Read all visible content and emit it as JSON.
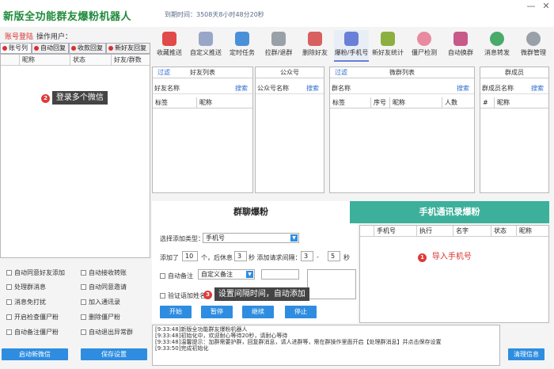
{
  "app": {
    "title": "新版全功能群友爆粉机器人",
    "expire": "到期时间：3508天8小时48分20秒",
    "login": "账号登陆",
    "op_user": "操作用户："
  },
  "window": {
    "min": "—",
    "close": "✕"
  },
  "toolbar": [
    {
      "label": "收藏推送",
      "icon": "star-icon",
      "color": "#e04a4a"
    },
    {
      "label": "自定义推送",
      "icon": "star-gear-icon",
      "color": "#9aa6c8"
    },
    {
      "label": "定时任务",
      "icon": "calendar-icon",
      "color": "#4a90d8"
    },
    {
      "label": "拉群/退群",
      "icon": "group-icon",
      "color": "#9aa0a8"
    },
    {
      "label": "删除好友",
      "icon": "delete-user-icon",
      "color": "#d86060"
    },
    {
      "label": "爆粉/手机号",
      "icon": "phone-id-icon",
      "color": "#6a7fd8"
    },
    {
      "label": "新好友统计",
      "icon": "user-stats-icon",
      "color": "#8cb040"
    },
    {
      "label": "僵尸检测",
      "icon": "zombie-face-icon",
      "color": "#e88aa0"
    },
    {
      "label": "自动换群",
      "icon": "switch-group-icon",
      "color": "#c85a8a"
    },
    {
      "label": "消息转发",
      "icon": "forward-icon",
      "color": "#4aaa6a"
    },
    {
      "label": "微群管理",
      "icon": "gear-icon",
      "color": "#9aa0a8"
    }
  ],
  "left": {
    "tabs": [
      "账号列",
      "自动回复",
      "收款回复",
      "新好友回复"
    ],
    "columns": [
      "昵称",
      "状态",
      "好友/群数"
    ],
    "tip_num": "2",
    "tip": "登录多个微信",
    "options": [
      [
        "自动同意好友添加",
        "自动接收转账"
      ],
      [
        "处理群消息",
        "自动同意邀请"
      ],
      [
        "消息免打扰",
        "加入通讯录"
      ],
      [
        "开启检查僵尸粉",
        "删除僵尸粉"
      ],
      [
        "自动备注僵尸粉",
        "自动退出异常群"
      ]
    ],
    "btn_login": "启动新微信",
    "btn_save": "保存设置"
  },
  "panels": {
    "friends": {
      "filter": "过滤",
      "title": "好友列表",
      "name": "好友名称",
      "search": "搜索",
      "cols": [
        "标签",
        "昵称"
      ]
    },
    "public": {
      "title": "公众号",
      "name": "公众号名称",
      "search": "搜索"
    },
    "groups": {
      "filter": "过滤",
      "title": "微群列表",
      "name": "群名称",
      "search": "搜索",
      "cols": [
        "标签",
        "序号",
        "昵称",
        "人数"
      ]
    },
    "members": {
      "title": "群成员",
      "name": "群成员名称",
      "search": "搜索",
      "cols": [
        "#",
        "昵称"
      ]
    }
  },
  "bigtabs": {
    "left": "群聊爆粉",
    "right": "手机通讯录爆粉"
  },
  "form": {
    "type_label": "选择添加类型：",
    "type_value": "手机号",
    "added": "添加了",
    "added_val": "10",
    "unit1": "个，后休息",
    "rest_val": "3",
    "unit2": "秒 添加请求间隔：",
    "int_a": "3",
    "dash": "-",
    "int_b": "5",
    "unit3": "秒",
    "remark": "自动备注",
    "remark_val": "自定义备注",
    "verify": "验证语加姓名",
    "tip_num": "3",
    "tip": "设置间隔时间，自动添加",
    "btn_start": "开始",
    "btn_pause": "暂停",
    "btn_continue": "继续",
    "btn_stop": "停止"
  },
  "phone": {
    "cols": [
      "手机号",
      "执行",
      "名字",
      "状态",
      "昵称"
    ],
    "tip_num": "1",
    "tip": "导入手机号"
  },
  "log": {
    "lines": [
      "[9:33:48]新版全功能群友爆粉机器人",
      "[9:33:48]初始化中，欢迎耐心等待20秒，请耐心等待",
      "[9:33:48]温馨提示：加群需要护群，回复群消息，请人进群等，需在群操作里面开启【处理群消息】并点击保存设置",
      "[9:33:50]完成初始化"
    ],
    "btn_clear": "清理信息"
  }
}
